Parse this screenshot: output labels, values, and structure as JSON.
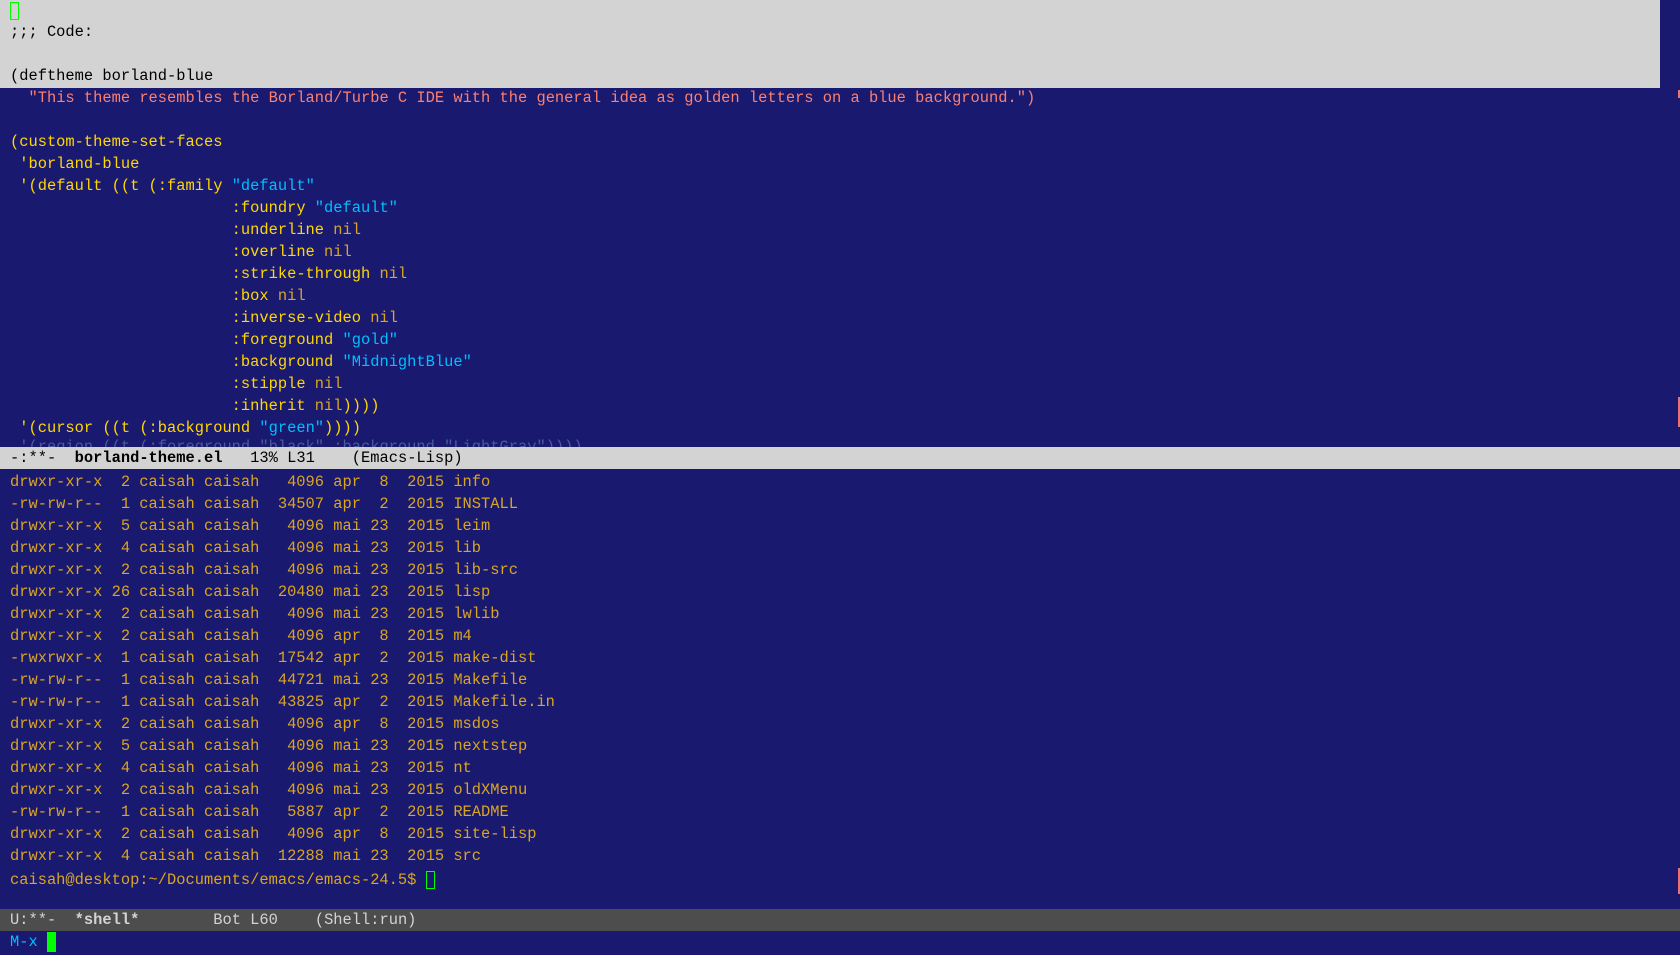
{
  "top_window": {
    "lines": [
      ";;; Code:",
      "",
      "(deftheme borland-blue",
      "  \"This theme resembles the Borland/Turbe C IDE with the general idea as golden letters on a blue background.\")",
      "",
      "(custom-theme-set-faces",
      " 'borland-blue",
      " '(default ((t (:family \"default\"",
      "                        :foundry \"default\"",
      "                        :underline nil",
      "                        :overline nil",
      "                        :strike-through nil",
      "                        :box nil",
      "                        :inverse-video nil",
      "                        :foreground \"gold\"",
      "                        :background \"MidnightBlue\"",
      "                        :stipple nil",
      "                        :inherit nil))))",
      " '(cursor ((t (:background \"green\"))))",
      " '(region ((t (:foreground \"black\" :background \"LightGray\"))))"
    ],
    "code": {
      "code_comment": ";;; Code:",
      "deftheme_line": "(deftheme borland-blue",
      "docstring": "\"This theme resembles the Borland/Turbe C IDE with the general idea as golden letters on a blue background.\")",
      "set_faces": "(custom-theme-set-faces",
      "theme_sym": "'borland-blue",
      "default_open": "'(default ((t (:family ",
      "family_val": "\"default\"",
      "foundry_key": ":foundry ",
      "foundry_val": "\"default\"",
      "underline_key": ":underline ",
      "overline_key": ":overline ",
      "strike_key": ":strike-through ",
      "box_key": ":box ",
      "inverse_key": ":inverse-video ",
      "foreground_key": ":foreground ",
      "foreground_val": "\"gold\"",
      "background_key": ":background ",
      "background_val": "\"MidnightBlue\"",
      "stipple_key": ":stipple ",
      "inherit_key": ":inherit ",
      "inherit_close": "))))",
      "nil": "nil",
      "cursor_open": "'(cursor ((t (:background ",
      "cursor_val": "\"green\"",
      "cursor_close": "))))",
      "region_partial": "'(region ((t (:foreground \"black\" :background \"LightGray\"))))"
    }
  },
  "top_modeline": {
    "status": "-:**-",
    "buffer": "borland-theme.el",
    "position": "13% L31",
    "mode": "(Emacs-Lisp)"
  },
  "shell": {
    "listing": [
      "drwxr-xr-x  2 caisah caisah   4096 apr  8  2015 info",
      "-rw-rw-r--  1 caisah caisah  34507 apr  2  2015 INSTALL",
      "drwxr-xr-x  5 caisah caisah   4096 mai 23  2015 leim",
      "drwxr-xr-x  4 caisah caisah   4096 mai 23  2015 lib",
      "drwxr-xr-x  2 caisah caisah   4096 mai 23  2015 lib-src",
      "drwxr-xr-x 26 caisah caisah  20480 mai 23  2015 lisp",
      "drwxr-xr-x  2 caisah caisah   4096 mai 23  2015 lwlib",
      "drwxr-xr-x  2 caisah caisah   4096 apr  8  2015 m4",
      "-rwxrwxr-x  1 caisah caisah  17542 apr  2  2015 make-dist",
      "-rw-rw-r--  1 caisah caisah  44721 mai 23  2015 Makefile",
      "-rw-rw-r--  1 caisah caisah  43825 apr  2  2015 Makefile.in",
      "drwxr-xr-x  2 caisah caisah   4096 apr  8  2015 msdos",
      "drwxr-xr-x  5 caisah caisah   4096 mai 23  2015 nextstep",
      "drwxr-xr-x  4 caisah caisah   4096 mai 23  2015 nt",
      "drwxr-xr-x  2 caisah caisah   4096 mai 23  2015 oldXMenu",
      "-rw-rw-r--  1 caisah caisah   5887 apr  2  2015 README",
      "drwxr-xr-x  2 caisah caisah   4096 apr  8  2015 site-lisp",
      "drwxr-xr-x  4 caisah caisah  12288 mai 23  2015 src"
    ],
    "prompt": "caisah@desktop:~/Documents/emacs/emacs-24.5$ "
  },
  "bottom_modeline": {
    "status": "U:**-",
    "buffer": "*shell*",
    "position": "Bot L60",
    "mode": "(Shell:run)"
  },
  "minibuffer": {
    "text": "M-x "
  },
  "colors": {
    "background": "#191970",
    "foreground": "#ffd700",
    "string": "#fa8072",
    "keyword_value": "#00bfff",
    "region": "#d3d3d3",
    "cursor": "#00ff00"
  }
}
